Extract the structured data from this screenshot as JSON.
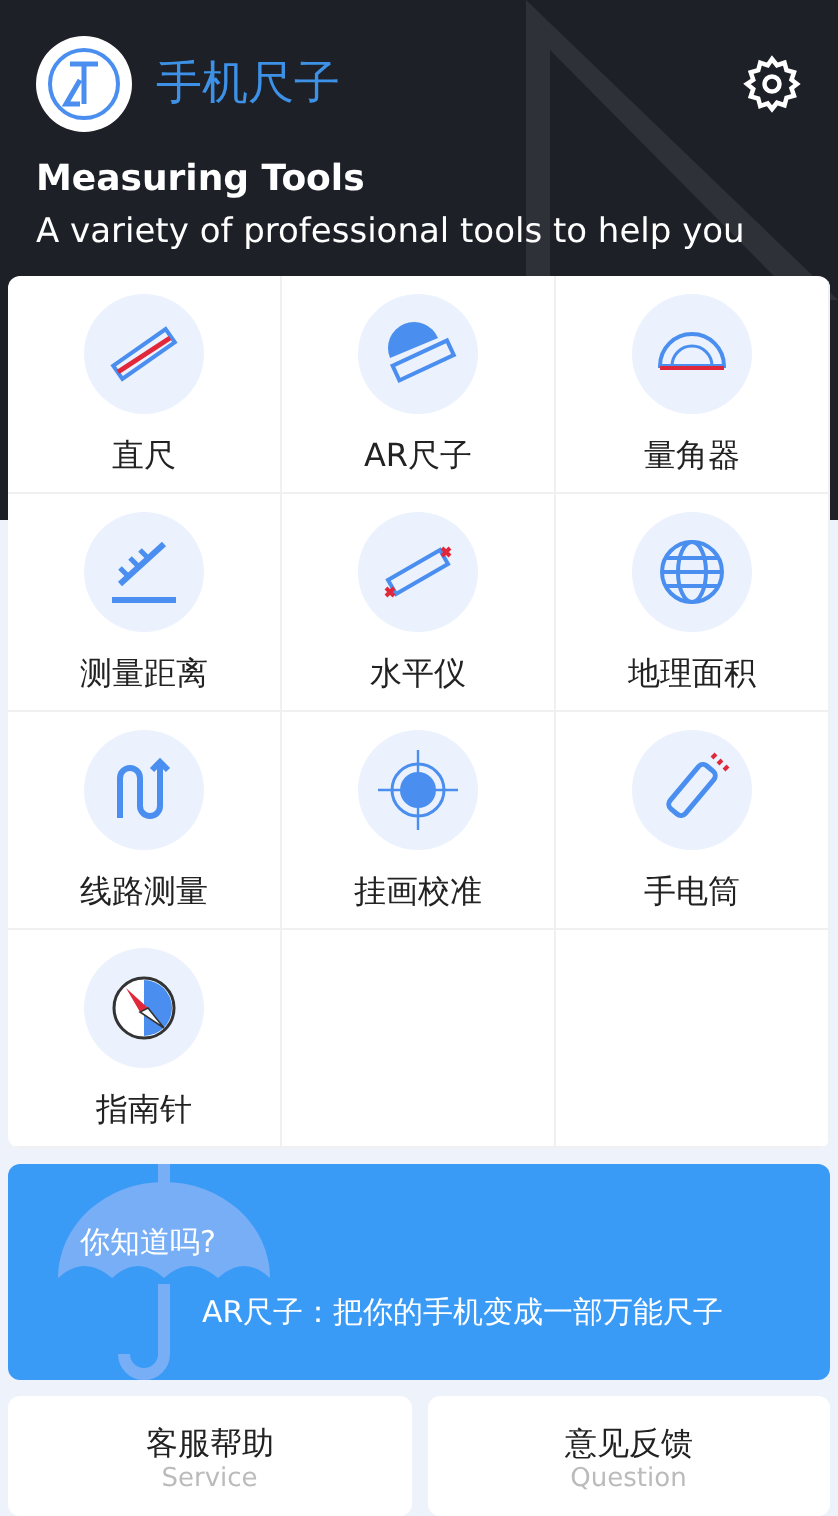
{
  "header": {
    "app_name": "手机尺子",
    "title": "Measuring Tools",
    "subtitle": "A variety of professional tools to help you"
  },
  "tools": [
    {
      "label": "直尺"
    },
    {
      "label": "AR尺子"
    },
    {
      "label": "量角器"
    },
    {
      "label": "测量距离"
    },
    {
      "label": "水平仪"
    },
    {
      "label": "地理面积"
    },
    {
      "label": "线路测量"
    },
    {
      "label": "挂画校准"
    },
    {
      "label": "手电筒"
    },
    {
      "label": "指南针"
    }
  ],
  "tip": {
    "heading": "你知道吗?",
    "text": "AR尺子：把你的手机变成一部万能尺子"
  },
  "footer": [
    {
      "label": "客服帮助",
      "sublabel": "Service"
    },
    {
      "label": "意见反馈",
      "sublabel": "Question"
    }
  ]
}
